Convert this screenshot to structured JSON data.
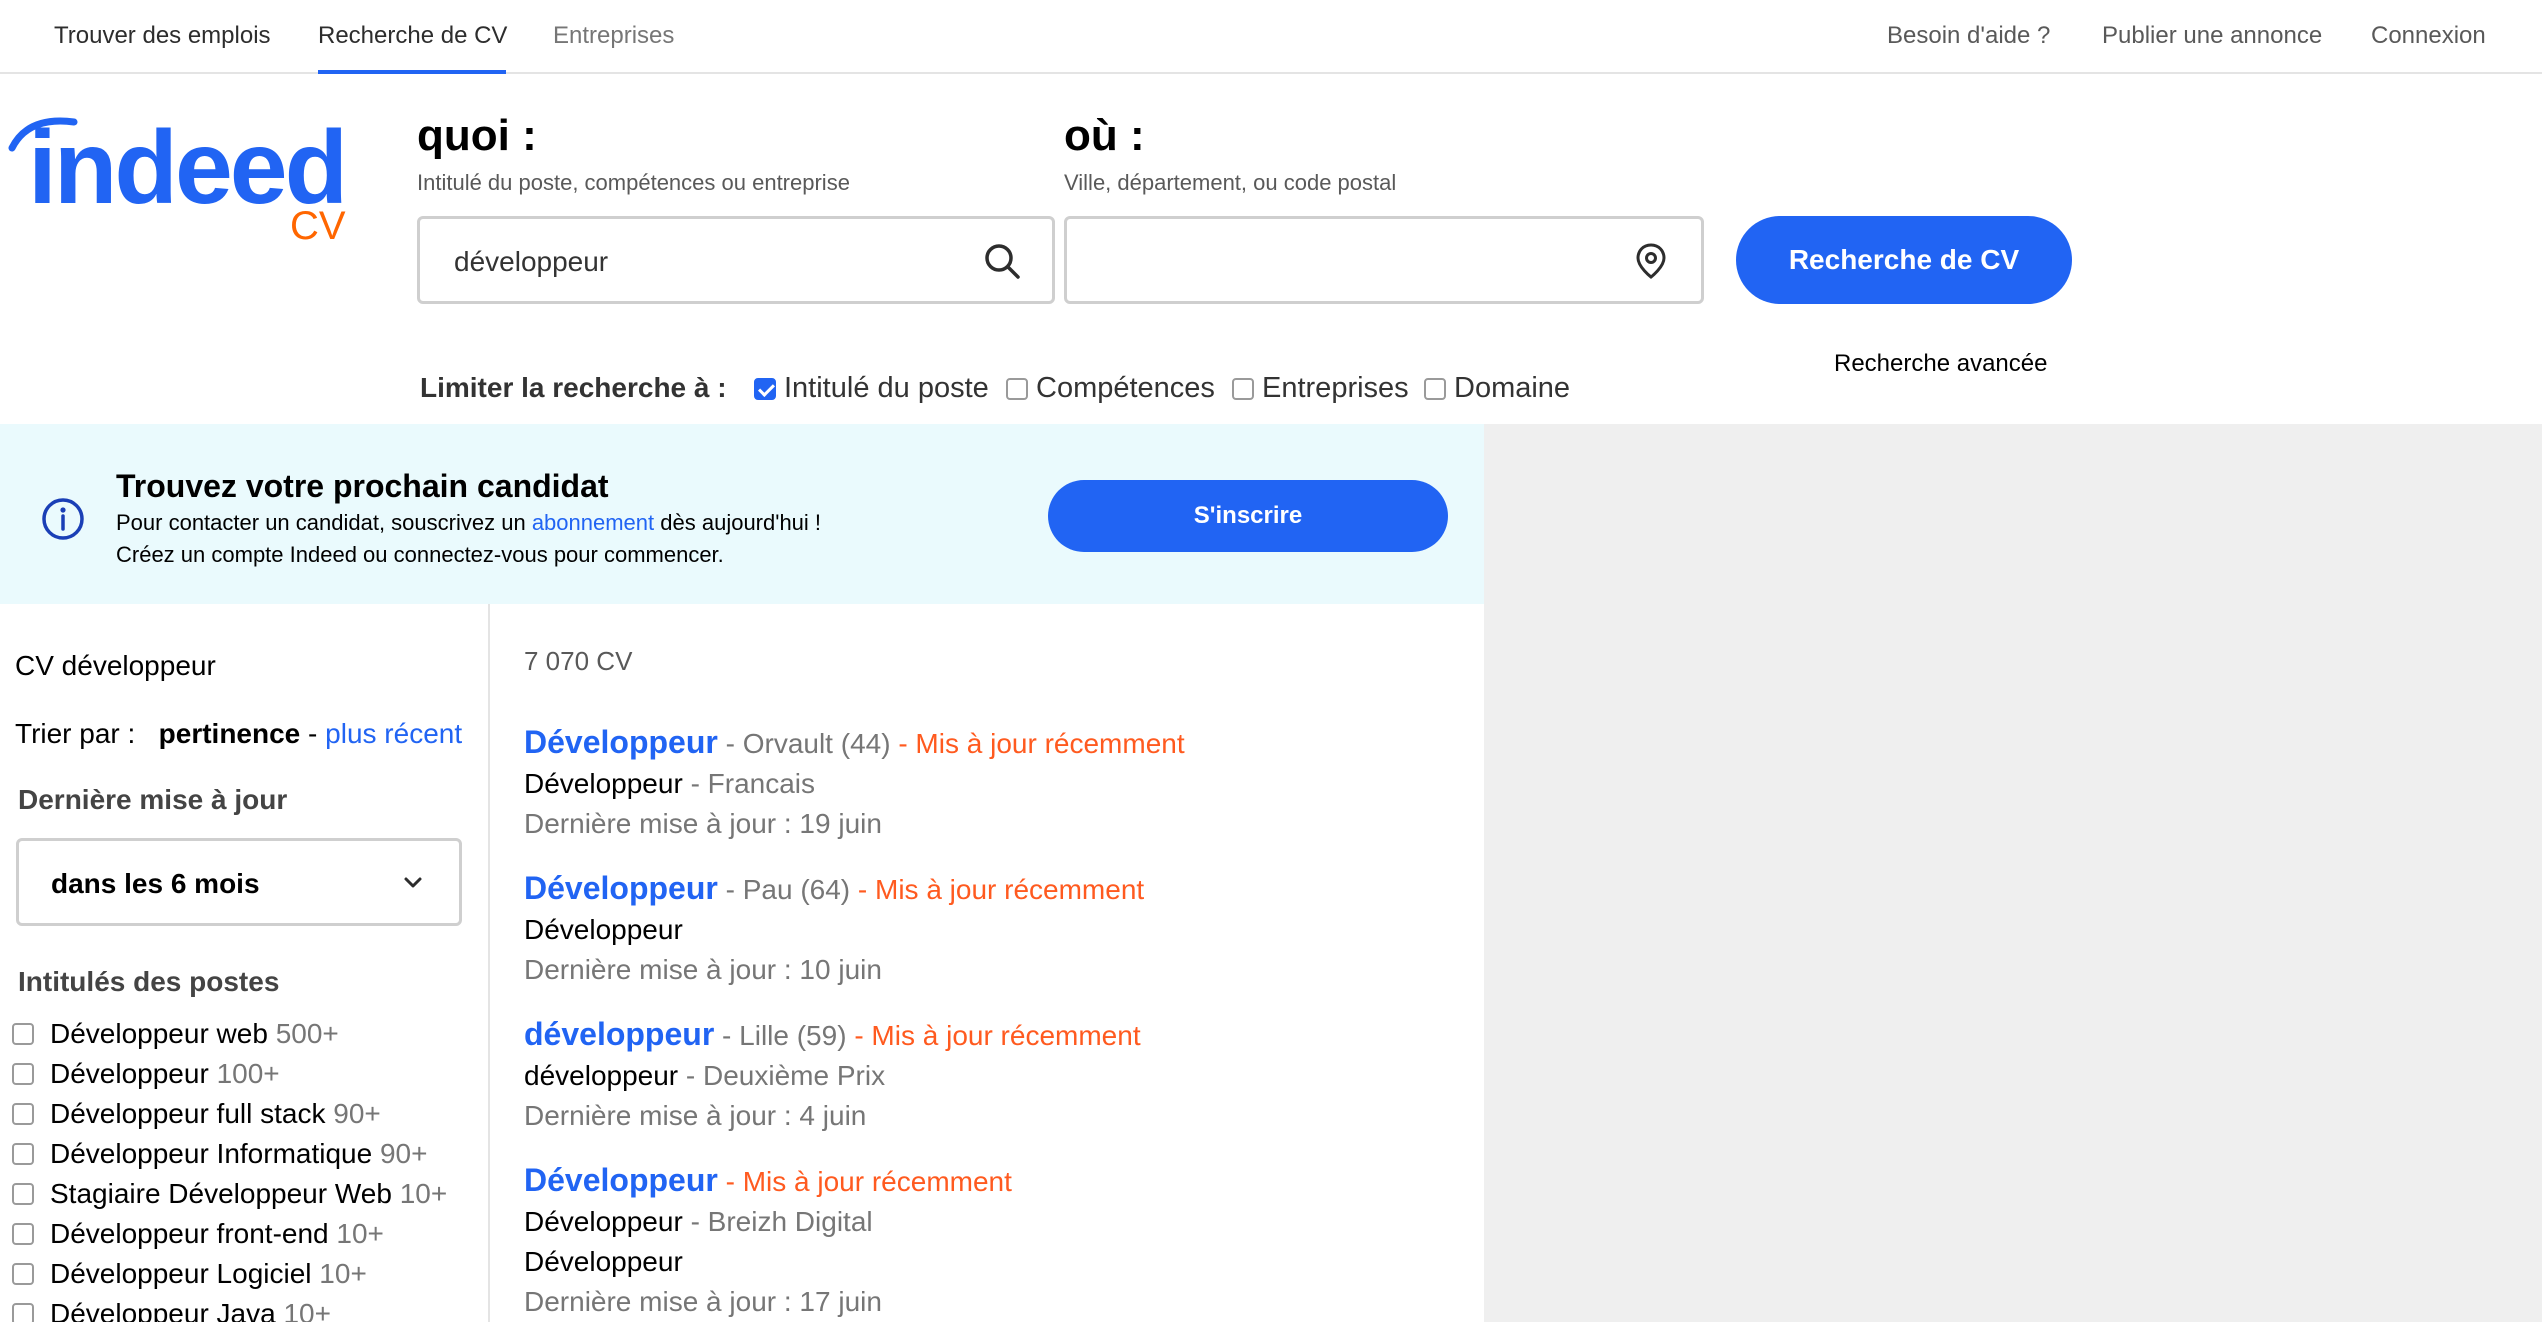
{
  "topnav": {
    "find_jobs": "Trouver des emplois",
    "cv_search": "Recherche de CV",
    "companies": "Entreprises",
    "help": "Besoin d'aide ?",
    "post_job": "Publier une annonce",
    "login": "Connexion"
  },
  "logo": {
    "word": "indeed",
    "sub": "CV"
  },
  "search": {
    "what_label": "quoi :",
    "what_hint": "Intitulé du poste, compétences ou entreprise",
    "what_value": "développeur",
    "where_label": "où :",
    "where_hint": "Ville, département, ou code postal",
    "where_value": "",
    "button": "Recherche de CV",
    "advanced": "Recherche avancée"
  },
  "limit": {
    "label": "Limiter la recherche à :",
    "options": [
      {
        "label": "Intitulé du poste",
        "checked": true
      },
      {
        "label": "Compétences",
        "checked": false
      },
      {
        "label": "Entreprises",
        "checked": false
      },
      {
        "label": "Domaine",
        "checked": false
      }
    ]
  },
  "banner": {
    "title": "Trouvez votre prochain candidat",
    "line1_pre": "Pour contacter un candidat, souscrivez un",
    "line1_link": "abonnement",
    "line1_post": "dès aujourd'hui !",
    "line2": "Créez un compte Indeed ou connectez-vous pour commencer.",
    "signup": "S'inscrire"
  },
  "sidebar": {
    "title": "CV développeur",
    "sort_label": "Trier par :",
    "sort_active": "pertinence",
    "sort_sep": "-",
    "sort_other": "plus récent",
    "update_heading": "Dernière mise à jour",
    "update_value": "dans les 6 mois",
    "titles_heading": "Intitulés des postes",
    "facets": [
      {
        "label": "Développeur web",
        "count": "500+"
      },
      {
        "label": "Développeur",
        "count": "100+"
      },
      {
        "label": "Développeur full stack",
        "count": "90+"
      },
      {
        "label": "Développeur Informatique",
        "count": "90+"
      },
      {
        "label": "Stagiaire Développeur Web",
        "count": "10+"
      },
      {
        "label": "Développeur front-end",
        "count": "10+"
      },
      {
        "label": "Développeur Logiciel",
        "count": "10+"
      },
      {
        "label": "Développeur Java",
        "count": "10+"
      }
    ]
  },
  "results": {
    "count": "7 070 CV",
    "items": [
      {
        "title": "Développeur",
        "location": "- Orvault (44)",
        "recent": "- Mis à jour récemment",
        "role": "Développeur",
        "company": "- Francais",
        "extra": "",
        "updated": "Dernière mise à jour : 19 juin"
      },
      {
        "title": "Développeur",
        "location": "- Pau (64)",
        "recent": "- Mis à jour récemment",
        "role": "Développeur",
        "company": "",
        "extra": "",
        "updated": "Dernière mise à jour : 10 juin"
      },
      {
        "title": "développeur",
        "location": "- Lille (59)",
        "recent": "- Mis à jour récemment",
        "role": "développeur",
        "company": "- Deuxième Prix",
        "extra": "",
        "updated": "Dernière mise à jour : 4 juin"
      },
      {
        "title": "Développeur",
        "location": "",
        "recent": "- Mis à jour récemment",
        "role": "Développeur",
        "company": "- Breizh Digital",
        "extra": "Développeur",
        "updated": "Dernière mise à jour : 17 juin"
      }
    ]
  }
}
